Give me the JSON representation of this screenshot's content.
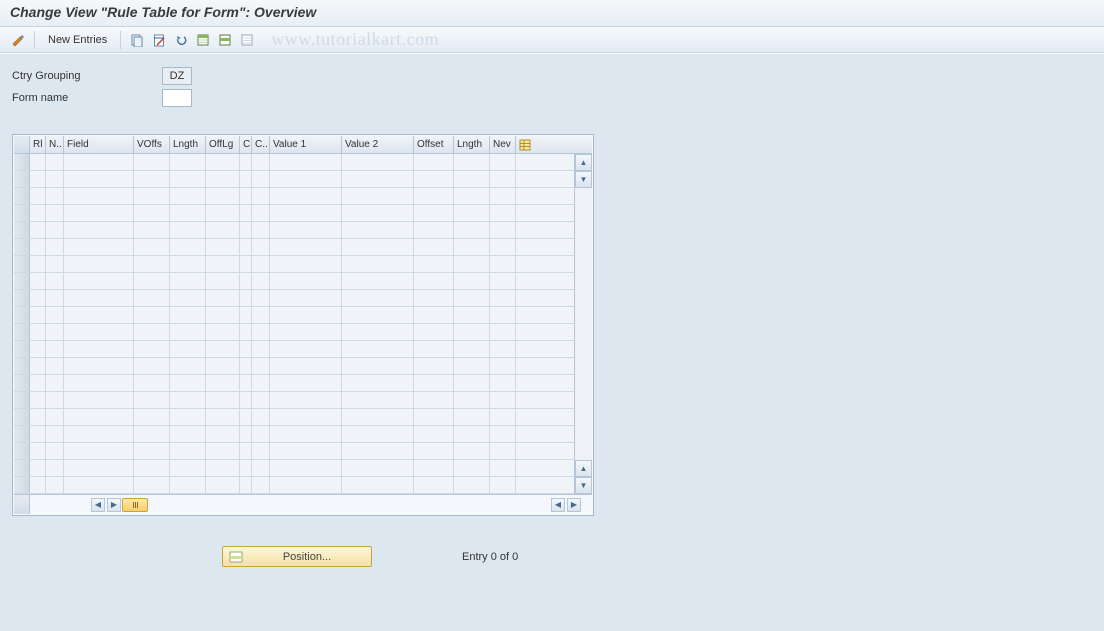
{
  "title": "Change View \"Rule Table for Form\": Overview",
  "watermark": "www.tutorialkart.com",
  "toolbar": {
    "new_entries_label": "New Entries",
    "icons": [
      "toggle",
      "new-entries",
      "copy",
      "delete",
      "undo",
      "select-all",
      "select-block",
      "deselect"
    ]
  },
  "header_fields": {
    "ctry_grouping": {
      "label": "Ctry Grouping",
      "value": "DZ"
    },
    "form_name": {
      "label": "Form name",
      "value": ""
    }
  },
  "table": {
    "columns": [
      "Rl",
      "N..",
      "Field",
      "VOffs",
      "Lngth",
      "OffLg",
      "C",
      "C..",
      "Value 1",
      "Value 2",
      "Offset",
      "Lngth",
      "Nev"
    ],
    "row_count": 20,
    "rows": []
  },
  "footer": {
    "position_label": "Position...",
    "entry_text": "Entry 0 of 0"
  },
  "colors": {
    "panel_bg": "#dde7f0",
    "border": "#a9b8c8",
    "accent": "#f4e3a0"
  }
}
